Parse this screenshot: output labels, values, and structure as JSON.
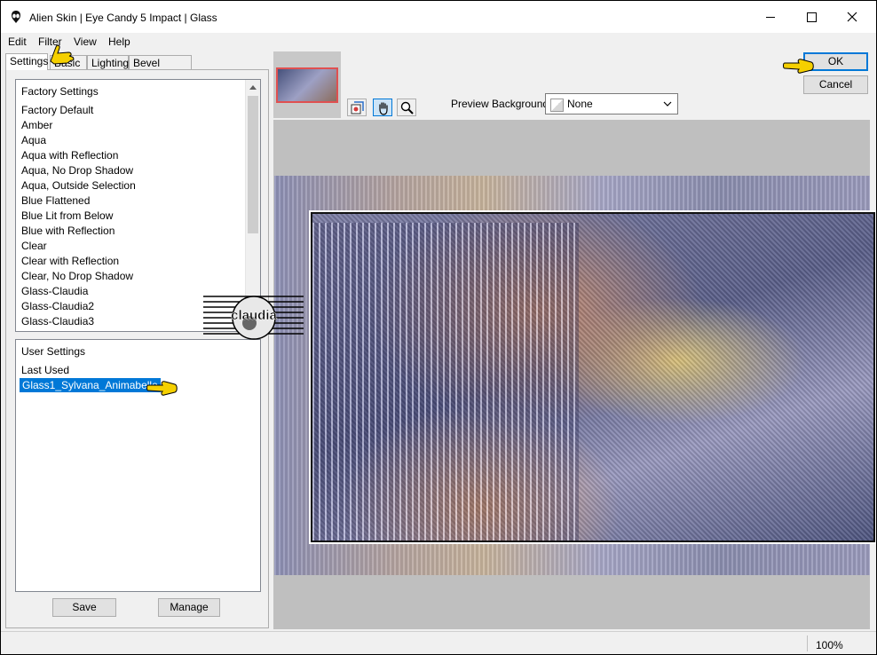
{
  "window": {
    "title": "Alien Skin | Eye Candy 5 Impact | Glass",
    "app_icon": "alien-skin-icon"
  },
  "menu": [
    "Edit",
    "Filter",
    "View",
    "Help"
  ],
  "tabs": [
    "Settings",
    "Basic",
    "Lighting",
    "Bevel Profile"
  ],
  "active_tab": "Settings",
  "factory_settings": {
    "header": "Factory Settings",
    "items": [
      "Factory Default",
      "Amber",
      "Aqua",
      "Aqua with Reflection",
      "Aqua, No Drop Shadow",
      "Aqua, Outside Selection",
      "Blue Flattened",
      "Blue Lit from Below",
      "Blue with Reflection",
      "Clear",
      "Clear with Reflection",
      "Clear, No Drop Shadow",
      "Glass-Claudia",
      "Glass-Claudia2",
      "Glass-Claudia3"
    ]
  },
  "user_settings": {
    "header": "User Settings",
    "items": [
      "Last Used",
      "Glass1_Sylvana_Animabelle"
    ],
    "selected": "Glass1_Sylvana_Animabelle"
  },
  "buttons": {
    "save": "Save",
    "manage": "Manage",
    "ok": "OK",
    "cancel": "Cancel"
  },
  "toolbar": {
    "tools": [
      "preview-toggle-icon",
      "hand-icon",
      "zoom-icon"
    ],
    "active_tool": "hand-icon"
  },
  "preview_background": {
    "label": "Preview Background:",
    "value": "None"
  },
  "status": {
    "zoom": "100%"
  },
  "watermark_text": "claudia",
  "colors": {
    "selection": "#0078d7",
    "pointer": "#f5d000"
  }
}
